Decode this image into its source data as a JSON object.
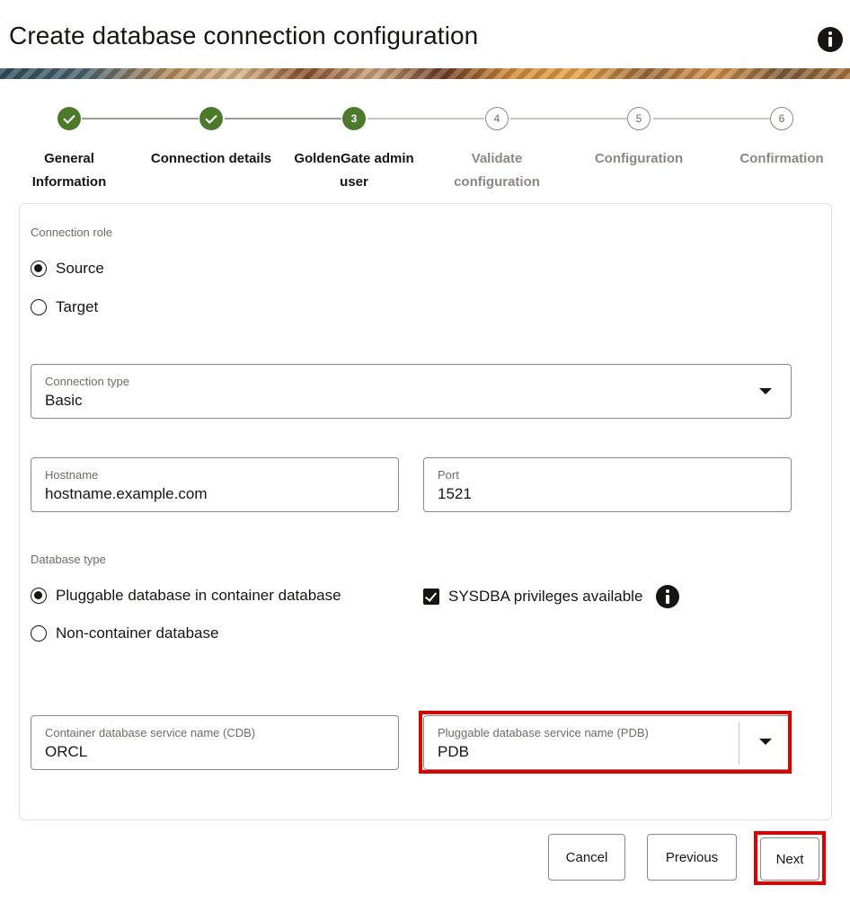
{
  "header": {
    "title": "Create database connection configuration",
    "help_icon": "info-icon"
  },
  "stepper": {
    "steps": [
      {
        "number": "1",
        "label_line1": "General",
        "label_line2": "Information",
        "state": "complete"
      },
      {
        "number": "2",
        "label_line1": "Connection details",
        "label_line2": "",
        "state": "complete"
      },
      {
        "number": "3",
        "label_line1": "GoldenGate admin",
        "label_line2": "user",
        "state": "current"
      },
      {
        "number": "4",
        "label_line1": "Validate",
        "label_line2": "configuration",
        "state": "pending"
      },
      {
        "number": "5",
        "label_line1": "Configuration",
        "label_line2": "",
        "state": "pending"
      },
      {
        "number": "6",
        "label_line1": "Confirmation",
        "label_line2": "",
        "state": "pending"
      }
    ]
  },
  "form": {
    "connection_role": {
      "label": "Connection role",
      "options": [
        "Source",
        "Target"
      ],
      "selected": "Source"
    },
    "connection_type": {
      "label": "Connection type",
      "value": "Basic"
    },
    "hostname": {
      "label": "Hostname",
      "value": "hostname.example.com"
    },
    "port": {
      "label": "Port",
      "value": "1521"
    },
    "database_type": {
      "label": "Database type",
      "options": [
        "Pluggable database in container database",
        "Non-container database"
      ],
      "selected": "Pluggable database in container database"
    },
    "sysdba": {
      "label": "SYSDBA privileges available",
      "checked": true
    },
    "cdb": {
      "label": "Container database service name (CDB)",
      "value": "ORCL"
    },
    "pdb": {
      "label": "Pluggable database service name (PDB)",
      "value": "PDB"
    }
  },
  "footer": {
    "cancel": "Cancel",
    "previous": "Previous",
    "next": "Next"
  },
  "colors": {
    "accent_green": "#4c7a2a",
    "highlight_red": "#e00000",
    "text": "#161513",
    "muted": "#6f6b66"
  }
}
